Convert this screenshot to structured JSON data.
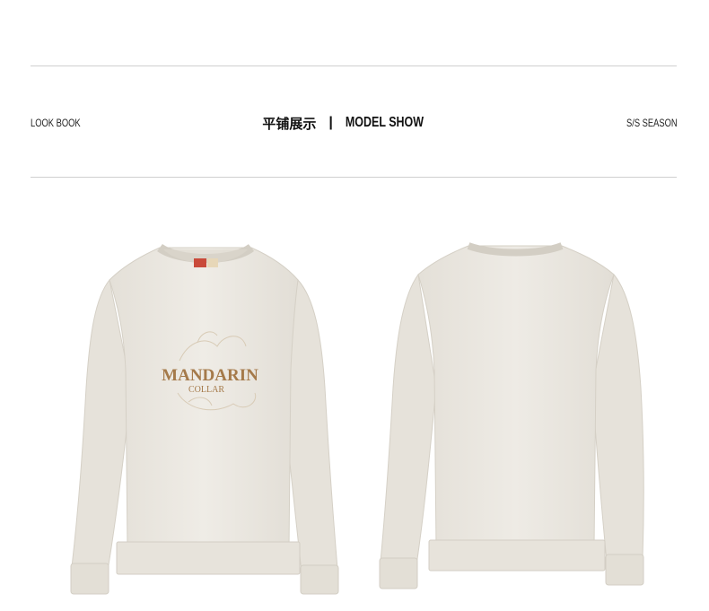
{
  "header": {
    "left_label": "LOOK BOOK",
    "center_cn": "平铺展示",
    "separator": "|",
    "center_en": "MODEL SHOW",
    "right_label": "S/S SEASON"
  },
  "products": {
    "front": {
      "embroidery_main": "MANDARIN",
      "embroidery_sub": "COLLAR"
    }
  },
  "colors": {
    "fabric": "#ebe8e1",
    "fabric_shadow": "#d9d5cc",
    "embroidery": "#a57a4a",
    "rule": "#cfcfcf"
  }
}
